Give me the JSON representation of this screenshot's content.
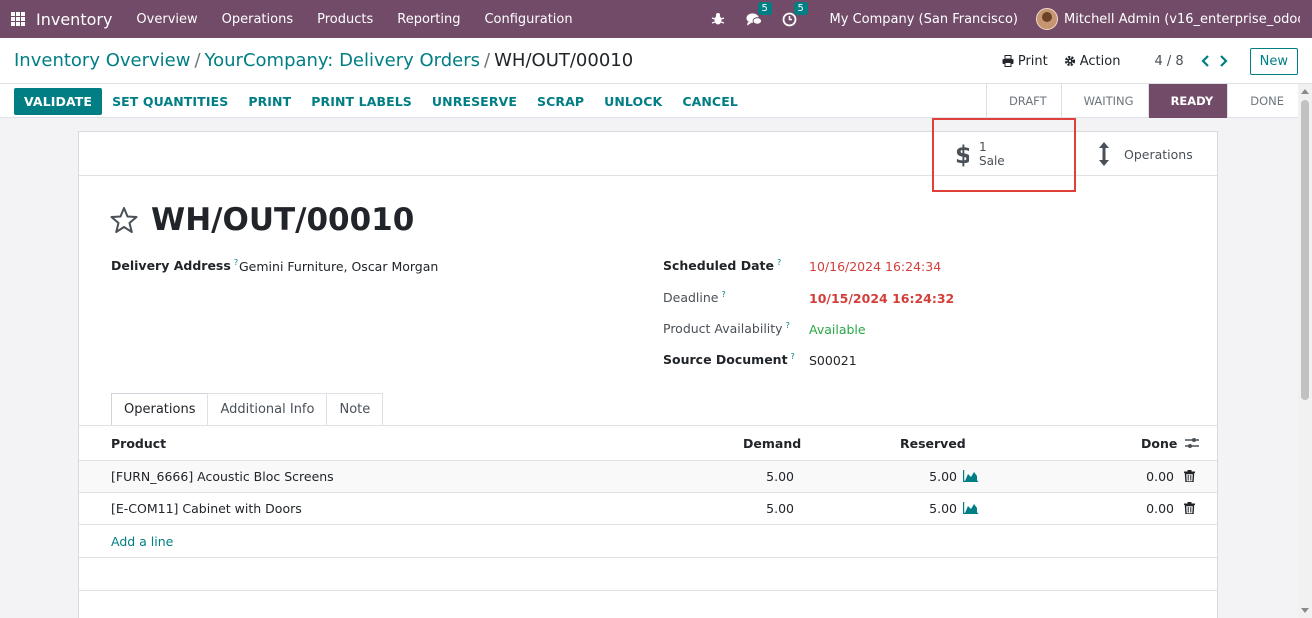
{
  "navbar": {
    "app_name": "Inventory",
    "menu": [
      "Overview",
      "Operations",
      "Products",
      "Reporting",
      "Configuration"
    ],
    "messages_count": "5",
    "activities_count": "5",
    "company": "My Company (San Francisco)",
    "user": "Mitchell Admin (v16_enterprise_odoo..."
  },
  "breadcrumb": {
    "items": [
      "Inventory Overview",
      "YourCompany: Delivery Orders"
    ],
    "current": "WH/OUT/00010"
  },
  "control": {
    "print_label": "Print",
    "action_label": "Action",
    "pager": "4 / 8",
    "new_label": "New"
  },
  "actions": [
    "VALIDATE",
    "SET QUANTITIES",
    "PRINT",
    "PRINT LABELS",
    "UNRESERVE",
    "SCRAP",
    "UNLOCK",
    "CANCEL"
  ],
  "stages": [
    "DRAFT",
    "WAITING",
    "READY",
    "DONE"
  ],
  "active_stage": "READY",
  "smart_buttons": {
    "sale_value": "1",
    "sale_label": "Sale",
    "operations_label": "Operations"
  },
  "record": {
    "title": "WH/OUT/00010",
    "delivery_address_label": "Delivery Address",
    "delivery_address": "Gemini Furniture, Oscar Morgan",
    "scheduled_date_label": "Scheduled Date",
    "scheduled_date": "10/16/2024 16:24:34",
    "deadline_label": "Deadline",
    "deadline": "10/15/2024 16:24:32",
    "availability_label": "Product Availability",
    "availability": "Available",
    "source_label": "Source Document",
    "source": "S00021",
    "help_mark": "?"
  },
  "tabs": [
    "Operations",
    "Additional Info",
    "Note"
  ],
  "table": {
    "headers": {
      "product": "Product",
      "demand": "Demand",
      "reserved": "Reserved",
      "done": "Done"
    },
    "rows": [
      {
        "product": "[FURN_6666] Acoustic Bloc Screens",
        "demand": "5.00",
        "reserved": "5.00",
        "done": "0.00"
      },
      {
        "product": "[E-COM11] Cabinet with Doors",
        "demand": "5.00",
        "reserved": "5.00",
        "done": "0.00"
      }
    ],
    "add_line": "Add a line"
  },
  "colors": {
    "brand": "#714b67",
    "accent": "#017e84",
    "danger": "#d23f3a",
    "success": "#28a745",
    "highlight": "#e0403a"
  }
}
